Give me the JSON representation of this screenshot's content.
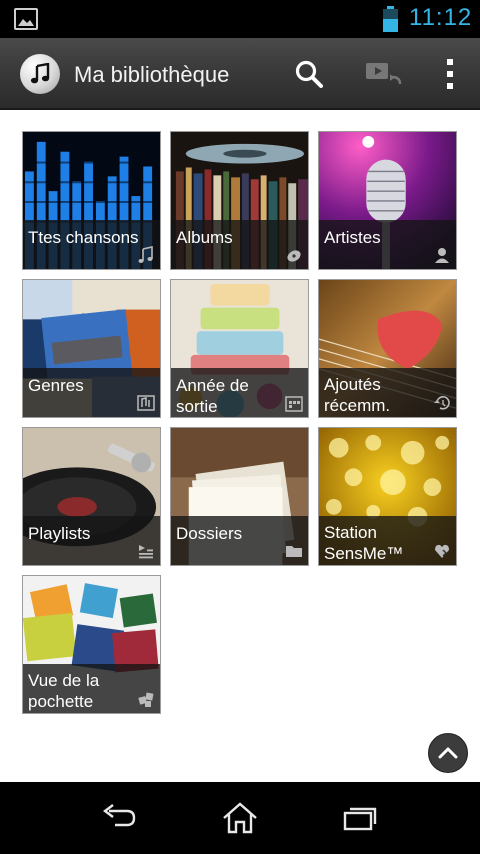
{
  "status_bar": {
    "time": "11:12",
    "notification_icon": "gallery-icon",
    "battery_icon": "battery-icon",
    "accent_color": "#33b5e5"
  },
  "action_bar": {
    "title": "Ma bibliothèque",
    "app_icon": "music-note-icon",
    "actions": [
      "search-icon",
      "play-on-device-icon",
      "overflow-menu-icon"
    ]
  },
  "library": {
    "tiles": [
      {
        "label": "Ttes chansons",
        "icon": "music-note-icon"
      },
      {
        "label": "Albums",
        "icon": "disc-icon"
      },
      {
        "label": "Artistes",
        "icon": "person-icon"
      },
      {
        "label": "Genres",
        "icon": "genre-icon"
      },
      {
        "label": "Année de sortie",
        "icon": "calendar-icon"
      },
      {
        "label": "Ajoutés récemm.",
        "icon": "history-icon"
      },
      {
        "label": "Playlists",
        "icon": "playlist-icon"
      },
      {
        "label": "Dossiers",
        "icon": "folder-icon"
      },
      {
        "label": "Station SensMe™",
        "icon": "sensme-icon"
      },
      {
        "label": "Vue de la pochette",
        "icon": "cover-view-icon"
      }
    ]
  },
  "fab": {
    "icon": "chevron-up-icon"
  },
  "nav_bar": {
    "buttons": [
      "back-icon",
      "home-icon",
      "recent-apps-icon"
    ]
  }
}
